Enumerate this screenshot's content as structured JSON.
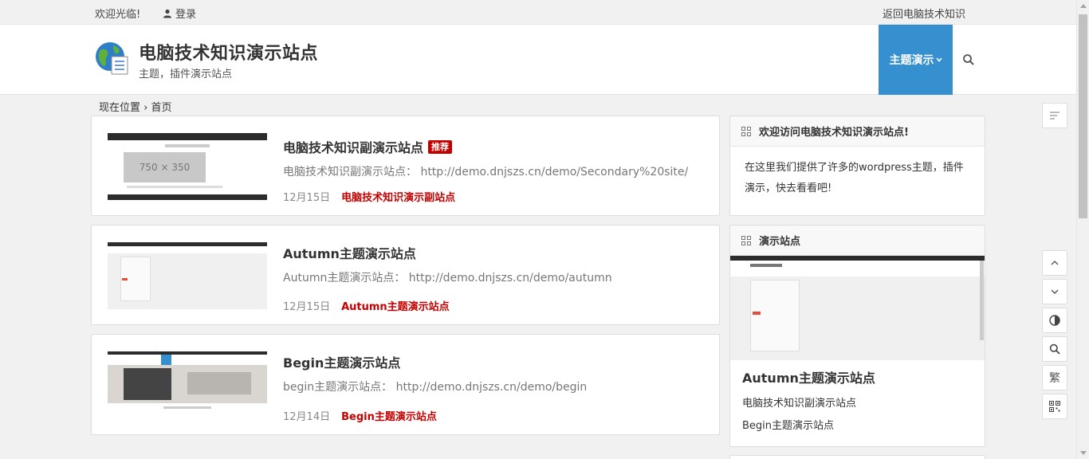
{
  "topbar": {
    "welcome": "欢迎光临!",
    "login": "登录",
    "back_link": "返回电脑技术知识"
  },
  "header": {
    "title": "电脑技术知识演示站点",
    "description": "主题，插件演示站点",
    "nav_item": "主题演示",
    "nav_color": "#3690cf"
  },
  "breadcrumb": {
    "location": "现在位置",
    "home": "首页"
  },
  "posts": [
    {
      "title": "电脑技术知识副演示站点",
      "badge": "推荐",
      "excerpt": "电脑技术知识副演示站点： http://demo.dnjszs.cn/demo/Secondary%20site/",
      "date": "12月15日",
      "category": "电脑技术知识演示副站点",
      "thumb_placeholder": "750 × 350"
    },
    {
      "title": "Autumn主题演示站点",
      "excerpt": "Autumn主题演示站点： http://demo.dnjszs.cn/demo/autumn",
      "date": "12月15日",
      "category": "Autumn主题演示站点"
    },
    {
      "title": "Begin主题演示站点",
      "excerpt": "begin主题演示站点： http://demo.dnjszs.cn/demo/begin",
      "date": "12月14日",
      "category": "Begin主题演示站点"
    }
  ],
  "sidebar": {
    "welcome_widget": {
      "title": "欢迎访问电脑技术知识演示站点!",
      "body": "在这里我们提供了许多的wordpress主题，插件演示，快去看看吧!"
    },
    "sites_widget": {
      "title": "演示站点",
      "featured": "Autumn主题演示站点",
      "links": [
        "电脑技术知识副演示站点",
        "Begin主题演示站点"
      ]
    }
  },
  "toolbar": {
    "traditional": "繁"
  },
  "colors": {
    "accent_red": "#c40000",
    "nav_blue": "#3690cf"
  }
}
